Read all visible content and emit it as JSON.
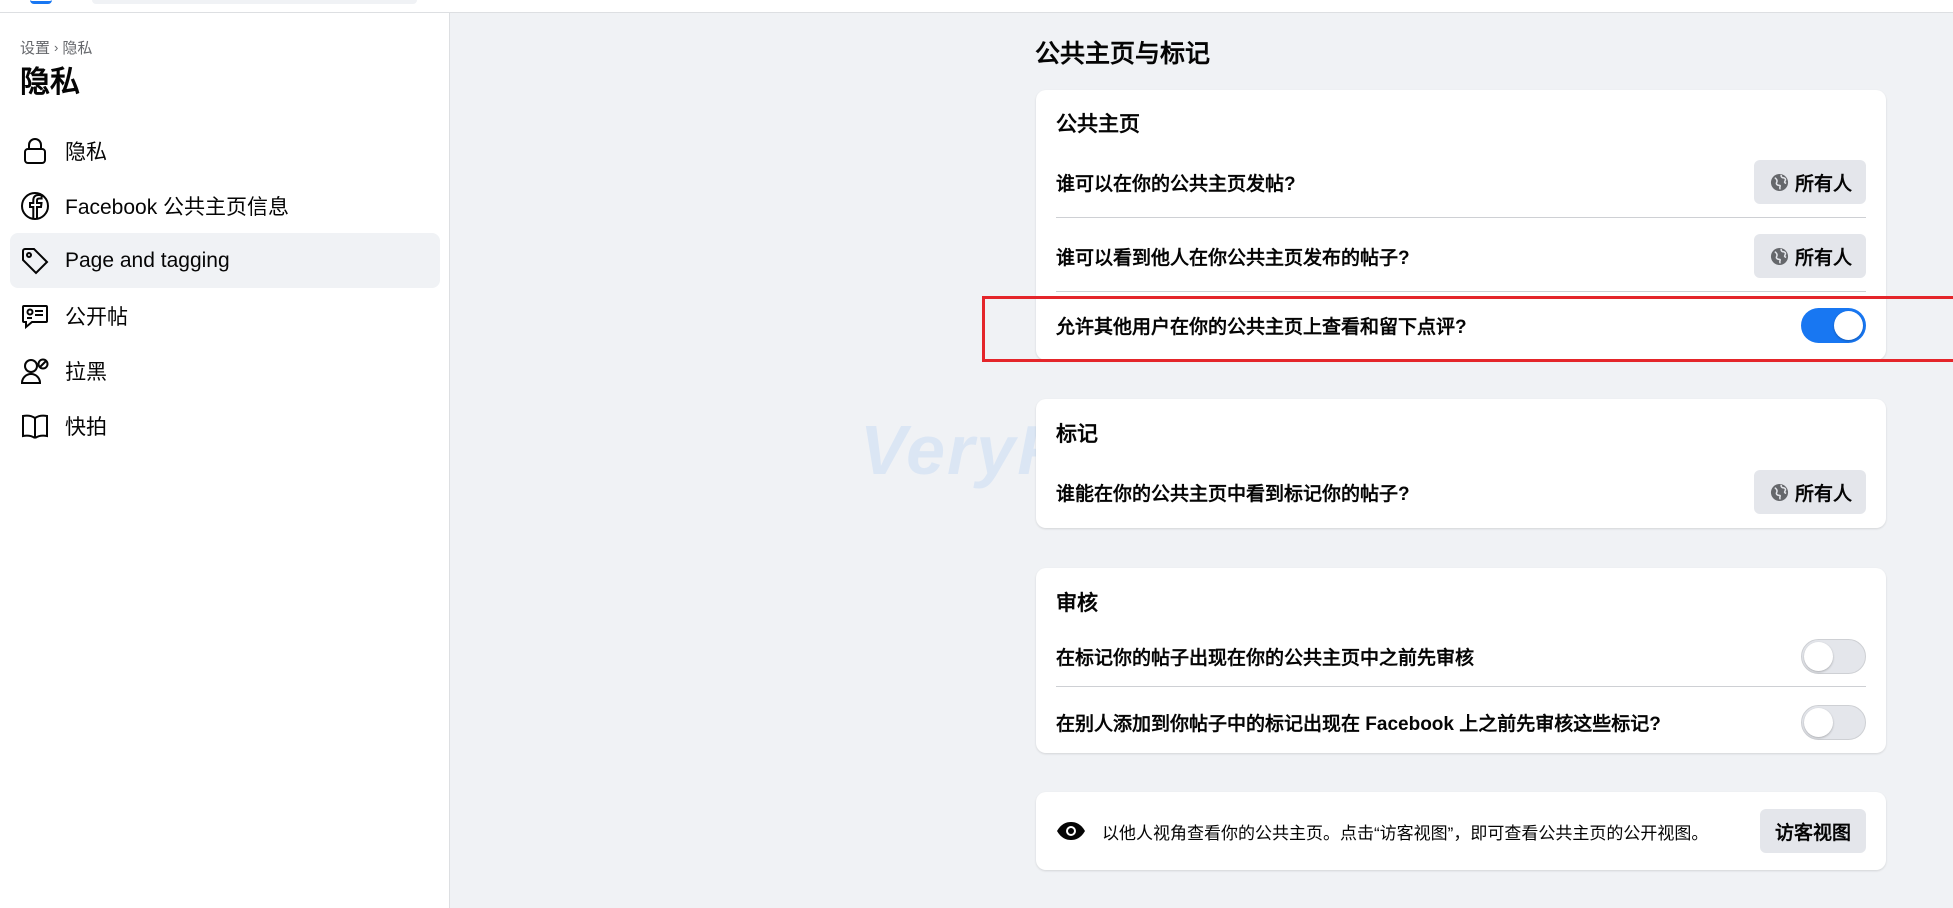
{
  "sidebar": {
    "breadcrumb": [
      "设置",
      "隐私"
    ],
    "breadcrumb_separator": "›",
    "title": "隐私",
    "items": [
      {
        "label": "隐私",
        "icon": "lock-icon",
        "active": false
      },
      {
        "label": "Facebook 公共主页信息",
        "icon": "facebook-logo-icon",
        "active": false
      },
      {
        "label": "Page and tagging",
        "icon": "tag-icon",
        "active": true
      },
      {
        "label": "公开帖",
        "icon": "public-posts-icon",
        "active": false
      },
      {
        "label": "拉黑",
        "icon": "block-user-icon",
        "active": false
      },
      {
        "label": "快拍",
        "icon": "book-icon",
        "active": false
      }
    ]
  },
  "main": {
    "title": "公共主页与标记",
    "page_section": {
      "heading": "公共主页",
      "rows": [
        {
          "label": "谁可以在你的公共主页发帖?",
          "control": "audience",
          "value": "所有人"
        },
        {
          "label": "谁可以看到他人在你公共主页发布的帖子?",
          "control": "audience",
          "value": "所有人"
        },
        {
          "label": "允许其他用户在你的公共主页上查看和留下点评?",
          "control": "toggle",
          "on": true
        }
      ]
    },
    "tagging_section": {
      "heading": "标记",
      "rows": [
        {
          "label": "谁能在你的公共主页中看到标记你的帖子?",
          "control": "audience",
          "value": "所有人"
        }
      ]
    },
    "review_section": {
      "heading": "审核",
      "rows": [
        {
          "label": "在标记你的帖子出现在你的公共主页中之前先审核",
          "control": "toggle",
          "on": false
        },
        {
          "label": "在别人添加到你帖子中的标记出现在 Facebook 上之前先审核这些标记?",
          "control": "toggle",
          "on": false
        }
      ]
    },
    "guest_view": {
      "icon": "eye-icon",
      "text": "以他人视角查看你的公共主页。点击“访客视图”，即可查看公共主页的公开视图。",
      "button_label": "访客视图"
    }
  },
  "watermark": "VeryFb",
  "colors": {
    "accent": "#1877f2",
    "highlight": "#e4252a",
    "background": "#f0f2f5",
    "button_gray": "#e4e6eb"
  }
}
